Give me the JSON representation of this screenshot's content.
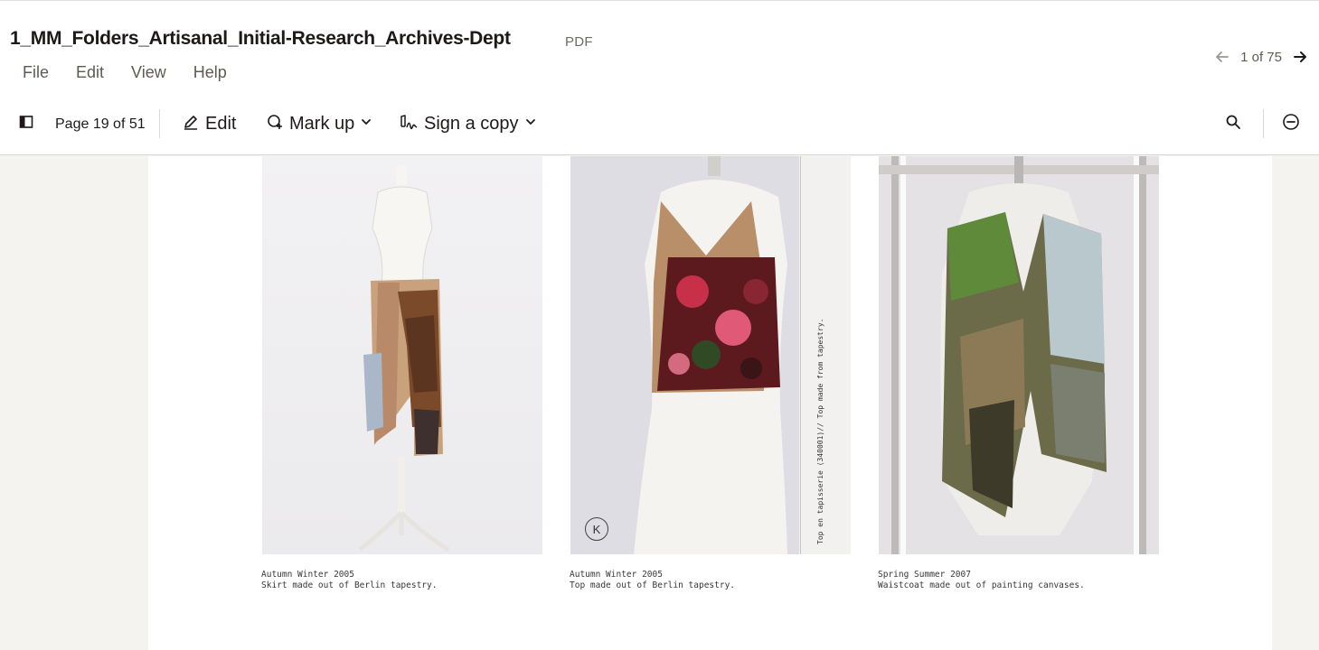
{
  "app": {
    "title": "1_MM_Folders_Artisanal_Initial-Research_Archives-Dept",
    "file_type": "PDF"
  },
  "menu": {
    "items": [
      {
        "label": "File"
      },
      {
        "label": "Edit"
      },
      {
        "label": "View"
      },
      {
        "label": "Help"
      }
    ]
  },
  "pager": {
    "count": "1 of 75",
    "prev_icon": "arrow-left-icon",
    "next_icon": "arrow-right-icon"
  },
  "toolbar": {
    "page_indicator": "Page 19 of 51",
    "edit_label": "Edit",
    "markup_label": "Mark up",
    "sign_label": "Sign a copy",
    "icons": [
      "sidebar-toggle-icon",
      "pencil-icon",
      "markup-icon",
      "signature-icon",
      "search-icon",
      "zoom-out-icon"
    ]
  },
  "document": {
    "items": [
      {
        "caption_line1": "Autumn Winter 2005",
        "caption_line2": "Skirt made out of Berlin tapestry."
      },
      {
        "caption_line1": "Autumn Winter 2005",
        "caption_line2": "Top made out of Berlin tapestry.",
        "side_note": "Top en tapisserie (340001)// Top made from tapestry.",
        "stamp": "K"
      },
      {
        "caption_line1": "Spring Summer 2007",
        "caption_line2": "Waistcoat made out of painting canvases."
      }
    ]
  }
}
